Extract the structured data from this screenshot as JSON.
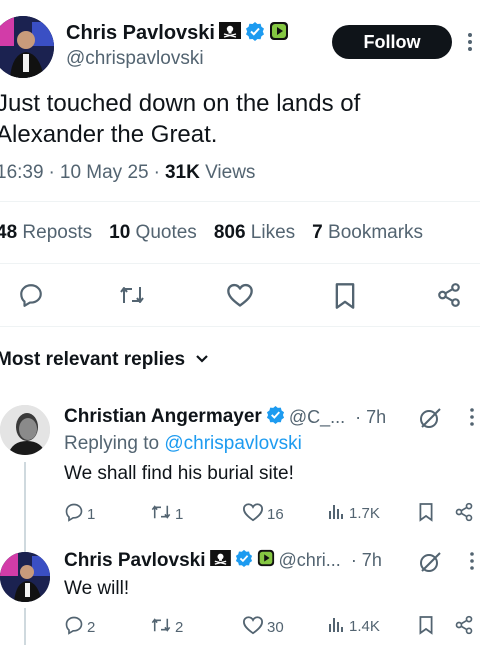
{
  "tweet": {
    "author_name": "Chris Pavlovski",
    "author_handle": "@chrispavlovski",
    "follow_label": "Follow",
    "text_line1": "Just touched down on the lands of",
    "text_line2": "Alexander the Great.",
    "time": "16:39",
    "date": "10 May 25",
    "views_count": "31K",
    "views_label": "Views",
    "sep": "·"
  },
  "stats": {
    "reposts_count": "48",
    "reposts_label": "Reposts",
    "quotes_count": "10",
    "quotes_label": "Quotes",
    "likes_count": "806",
    "likes_label": "Likes",
    "bookmarks_count": "7",
    "bookmarks_label": "Bookmarks"
  },
  "replies_header": "Most relevant replies",
  "replies": [
    {
      "name": "Christian Angermayer",
      "handle": "@C_...",
      "time": "· 7h",
      "replying_prefix": "Replying to",
      "replying_to": "@chrispavlovski",
      "text": "We shall find his burial site!",
      "replies": "1",
      "reposts": "1",
      "likes": "16",
      "views": "1.7K"
    },
    {
      "name": "Chris Pavlovski",
      "handle": "@chri...",
      "time": "· 7h",
      "text": "We will!",
      "replies": "2",
      "reposts": "2",
      "likes": "30",
      "views": "1.4K"
    }
  ],
  "colors": {
    "accent": "#1d9bf0",
    "text": "#0f1419",
    "muted": "#536471",
    "divider": "#eff3f4",
    "button": "#0f1419"
  }
}
